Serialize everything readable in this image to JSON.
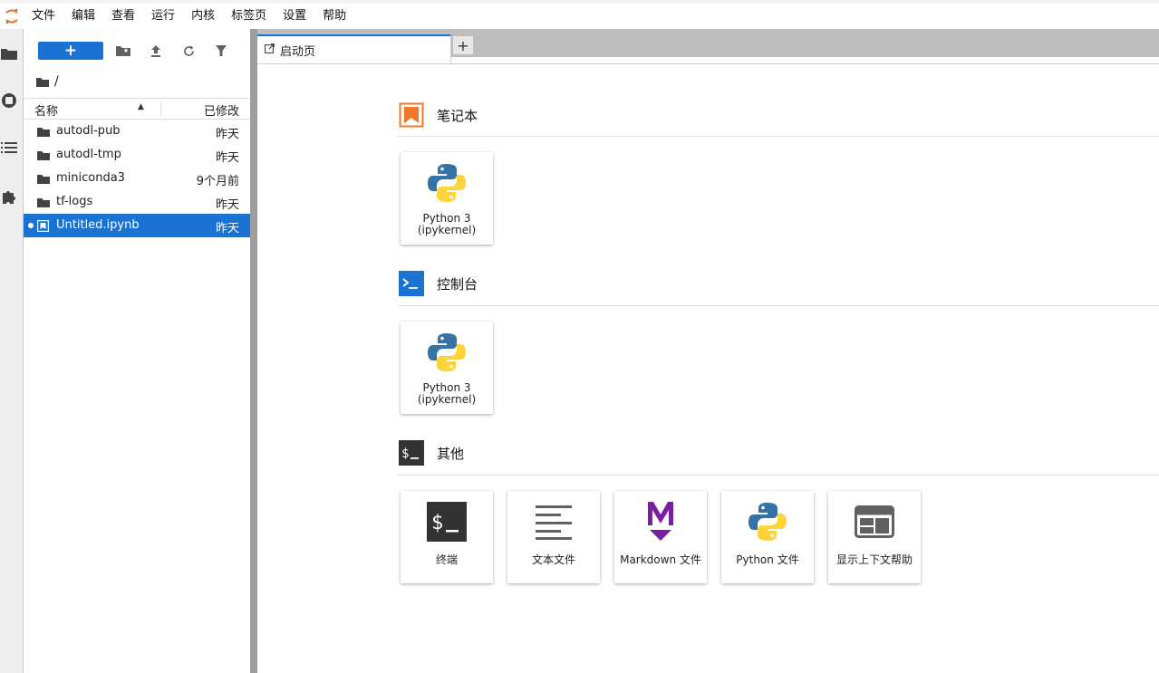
{
  "menu": [
    "文件",
    "编辑",
    "查看",
    "运行",
    "内核",
    "标签页",
    "设置",
    "帮助"
  ],
  "left_strip_icons": [
    "folder-icon",
    "running-icon",
    "toc-icon",
    "extension-icon"
  ],
  "file_browser": {
    "new_button_label": "+",
    "breadcrumb": "/",
    "header_name": "名称",
    "header_modified": "已修改",
    "files": [
      {
        "name": "autodl-pub",
        "modified": "昨天",
        "type": "folder"
      },
      {
        "name": "autodl-tmp",
        "modified": "昨天",
        "type": "folder"
      },
      {
        "name": "miniconda3",
        "modified": "9个月前",
        "type": "folder"
      },
      {
        "name": "tf-logs",
        "modified": "昨天",
        "type": "folder"
      },
      {
        "name": "Untitled.ipynb",
        "modified": "昨天",
        "type": "notebook",
        "selected": true
      }
    ]
  },
  "tabs": {
    "active_label": "启动页",
    "add_label": "+"
  },
  "launcher": {
    "sections": [
      {
        "title": "笔记本",
        "cards": [
          {
            "line1": "Python 3",
            "line2": "(ipykernel)"
          }
        ]
      },
      {
        "title": "控制台",
        "cards": [
          {
            "line1": "Python 3",
            "line2": "(ipykernel)"
          }
        ]
      },
      {
        "title": "其他",
        "cards": [
          {
            "label": "终端"
          },
          {
            "label": "文本文件"
          },
          {
            "label": "Markdown 文件"
          },
          {
            "label": "Python 文件"
          },
          {
            "label": "显示上下文帮助"
          }
        ]
      }
    ]
  },
  "colors": {
    "accent": "#1a73d2",
    "notebook_orange": "#f37726",
    "markdown_purple": "#7b1fa2"
  }
}
